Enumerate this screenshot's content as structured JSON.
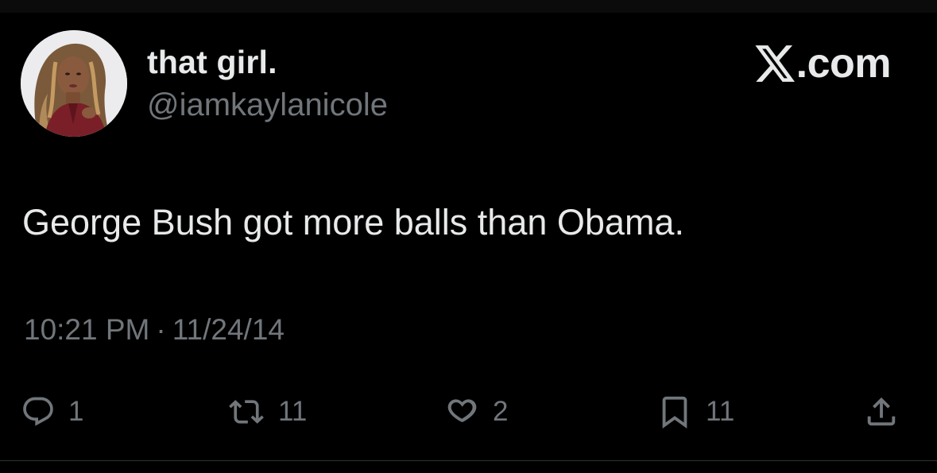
{
  "author": {
    "display_name": "that girl.",
    "handle": "@iamkaylanicole"
  },
  "brand": {
    "text": ".com",
    "icon": "x-logo-icon"
  },
  "tweet": {
    "text": "George Bush got more balls than Obama.",
    "time": "10:21 PM",
    "separator": "·",
    "date": "11/24/14"
  },
  "actions": {
    "reply": {
      "icon": "reply-icon",
      "count": "1"
    },
    "repost": {
      "icon": "repost-icon",
      "count": "11"
    },
    "like": {
      "icon": "heart-icon",
      "count": "2"
    },
    "bookmark": {
      "icon": "bookmark-icon",
      "count": "11"
    },
    "share": {
      "icon": "share-icon"
    }
  },
  "colors": {
    "background": "#000000",
    "primary_text": "#e7e9ea",
    "secondary_text": "#71767b",
    "divider": "#2f3336"
  }
}
